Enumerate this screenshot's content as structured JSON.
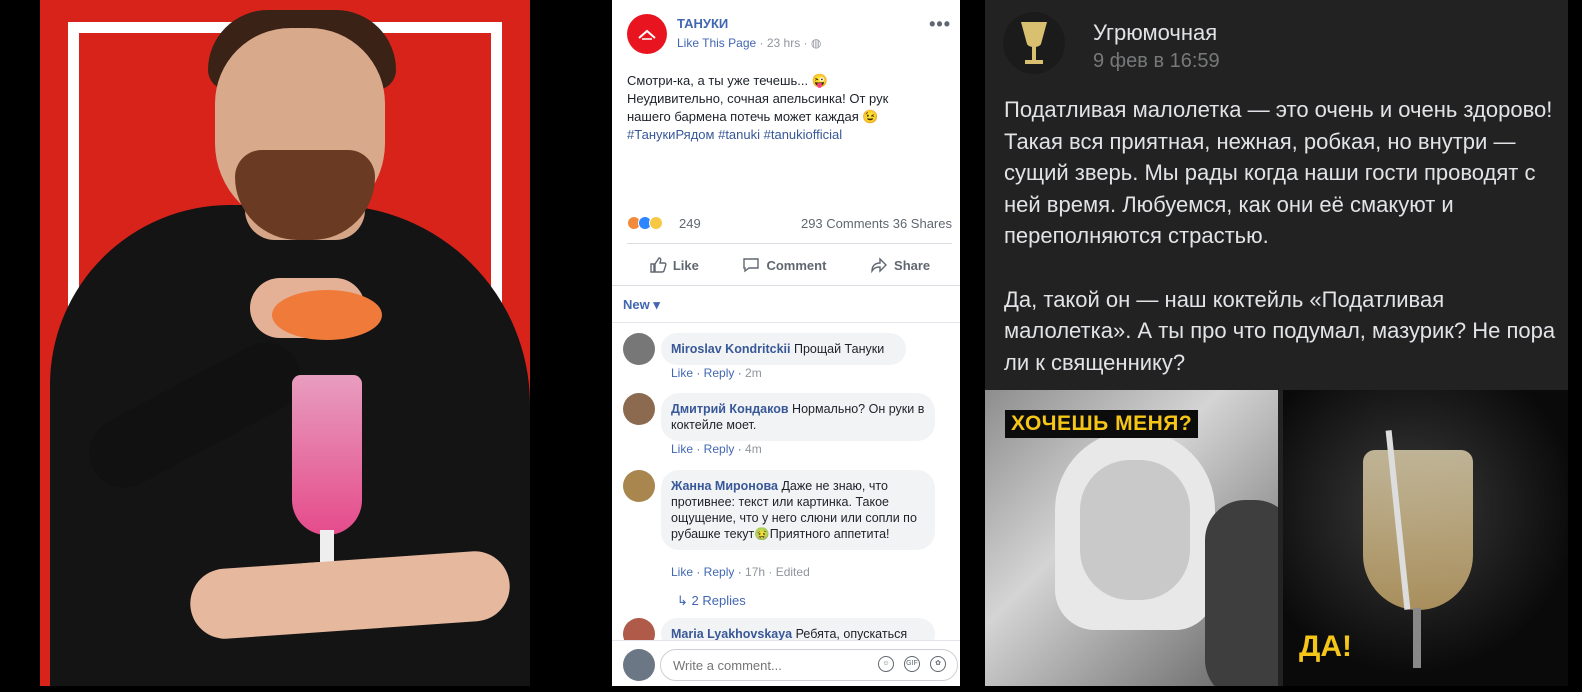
{
  "fb": {
    "page_name": "ТАНУКИ",
    "like_page": "Like This Page",
    "post_time": "· 23 hrs ·",
    "globe_icon": "globe-icon",
    "more": "•••",
    "post_lines": [
      "Смотри-ка, а ты уже течешь... 😜",
      "Неудивительно, сочная апельсинка! От рук",
      "нашего бармена потечь может каждая 😉"
    ],
    "hashtags": "#ТанукиРядом #tanuki #tanukiofficial",
    "reaction_count": "249",
    "comments_shares": "293 Comments  36 Shares",
    "actions": {
      "like": "Like",
      "comment": "Comment",
      "share": "Share"
    },
    "sort_label": "New ▾",
    "comments": [
      {
        "author": "Miroslav Kondritckii",
        "text": "Прощай Тануки",
        "actions": "Like · Reply · ",
        "time": "2m"
      },
      {
        "author": "Дмитрий Кондаков",
        "text": "Нормально? Он руки в коктейле моет.",
        "actions": "Like · Reply · ",
        "time": "4m"
      },
      {
        "author": "Жанна Миронова",
        "text": "Даже не знаю, что противнее: текст или картинка. Такое ощущение, что у него слюни или сопли по рубашке текут🤢Приятного аппетита!",
        "actions": "Like · Reply · ",
        "time": "17h · Edited"
      },
      {
        "author": "Maria Lyakhovskaya",
        "text": "Ребята, опускаться"
      }
    ],
    "replies": "↳  2 Replies",
    "compose_placeholder": "Write a comment...",
    "compose_icons": [
      "emoji-icon",
      "gif-icon",
      "sticker-icon"
    ],
    "brand_color": "#e8141f",
    "link_color": "#4267b2"
  },
  "vk": {
    "name": "Угрюмочная",
    "date": "9 фев в 16:59",
    "paragraphs": [
      "Податливая малолетка — это очень и очень здорово! Такая вся приятная, нежная, робкая, но внутри — сущий зверь. Мы рады когда наши гости проводят с ней время. Любуемся, как они её смакуют и переполняются страстью.",
      "Да, такой он — наш коктейль «Податливая малолетка». А ты про что подумал, мазурик? Не пора ли к священнику?"
    ],
    "caption_a": "ХОЧЕШЬ МЕНЯ?",
    "caption_b": "ДА!",
    "caption_color": "#f5c518",
    "bg_color": "#222222"
  }
}
